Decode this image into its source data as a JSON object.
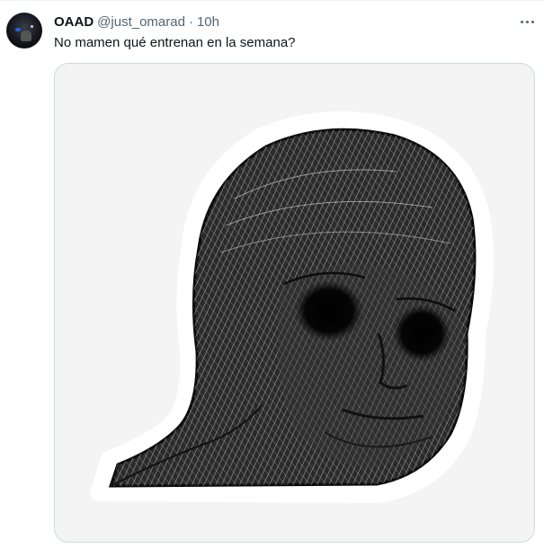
{
  "tweet": {
    "display_name": "OAAD",
    "handle": "@just_omarad",
    "separator": "·",
    "time": "10h",
    "text": "No mamen qué entrenan en la semana?",
    "avatar": "user-avatar",
    "more_icon": "more-horizontal-icon",
    "media": {
      "description_icon": "wojak-sticker-image"
    }
  },
  "colors": {
    "text_primary": "#0f1419",
    "text_secondary": "#536471",
    "border": "#cfd9de",
    "media_background": "#f4f4f4"
  }
}
